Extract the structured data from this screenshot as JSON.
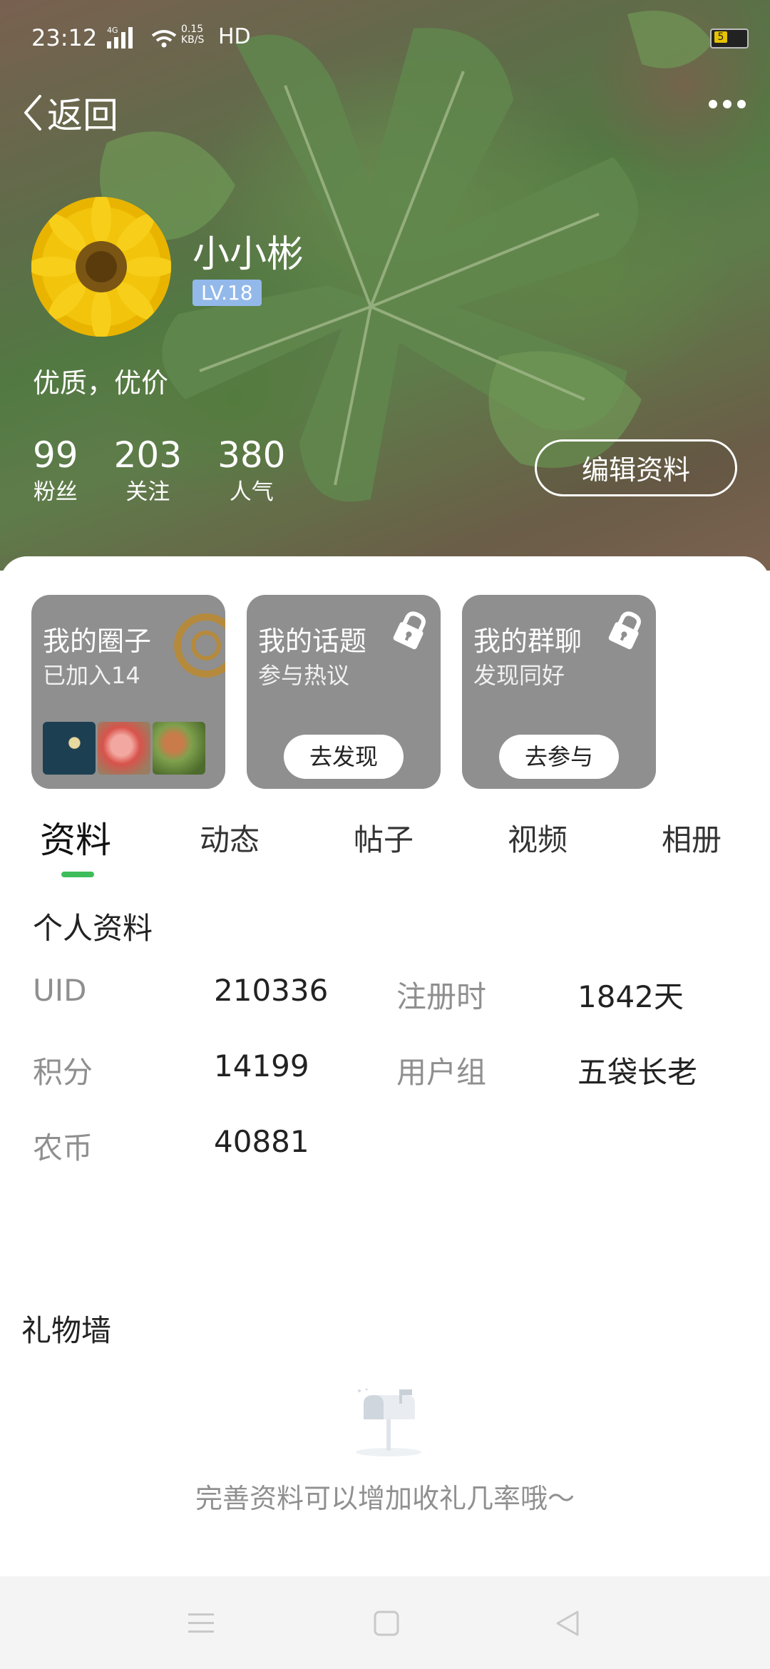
{
  "status_bar": {
    "time": "23:12",
    "network": "4G",
    "speed_value": "0.15",
    "speed_unit": "KB/S",
    "hd": "HD",
    "battery": "5"
  },
  "nav": {
    "back_label": "返回"
  },
  "profile": {
    "username": "小小彬",
    "level": "LV.18",
    "bio": "优质，优价",
    "edit_label": "编辑资料",
    "stats": [
      {
        "value": "99",
        "label": "粉丝"
      },
      {
        "value": "203",
        "label": "关注"
      },
      {
        "value": "380",
        "label": "人气"
      }
    ]
  },
  "cards": [
    {
      "title": "我的圈子",
      "subtitle": "已加入14",
      "button": ""
    },
    {
      "title": "我的话题",
      "subtitle": "参与热议",
      "button": "去发现"
    },
    {
      "title": "我的群聊",
      "subtitle": "发现同好",
      "button": "去参与"
    }
  ],
  "tabs": [
    "资料",
    "动态",
    "帖子",
    "视频",
    "相册"
  ],
  "personal_info": {
    "title": "个人资料",
    "rows": [
      {
        "label": "UID",
        "value": "210336"
      },
      {
        "label": "注册时",
        "value": "1842天"
      },
      {
        "label": "积分",
        "value": "14199"
      },
      {
        "label": "用户组",
        "value": "五袋长老"
      },
      {
        "label": "农币",
        "value": "40881"
      }
    ]
  },
  "gift_wall": {
    "title": "礼物墙",
    "empty_text": "完善资料可以增加收礼几率哦～"
  },
  "colors": {
    "accent": "#3fbd5a",
    "level_badge": "#93b9ea",
    "card_bg": "#8f8f8f"
  }
}
